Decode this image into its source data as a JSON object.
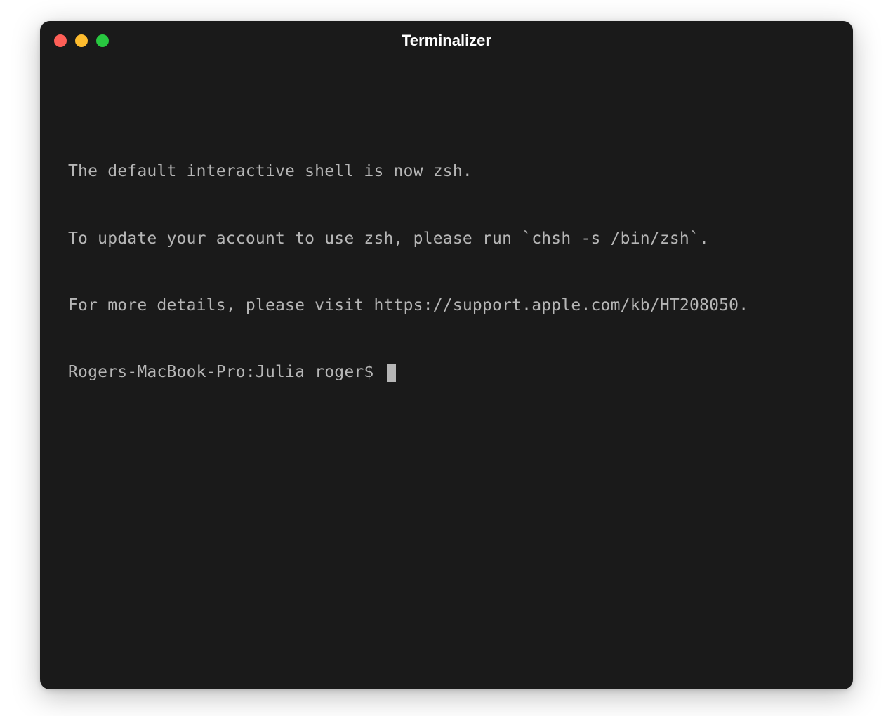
{
  "window": {
    "title": "Terminalizer"
  },
  "terminal": {
    "lines": [
      "The default interactive shell is now zsh.",
      "To update your account to use zsh, please run `chsh -s /bin/zsh`.",
      "For more details, please visit https://support.apple.com/kb/HT208050."
    ],
    "prompt": "Rogers-MacBook-Pro:Julia roger$ "
  },
  "colors": {
    "close": "#ff5f57",
    "minimize": "#febc2e",
    "maximize": "#28c840",
    "background": "#1a1a1a",
    "text": "#b6b6b6"
  }
}
